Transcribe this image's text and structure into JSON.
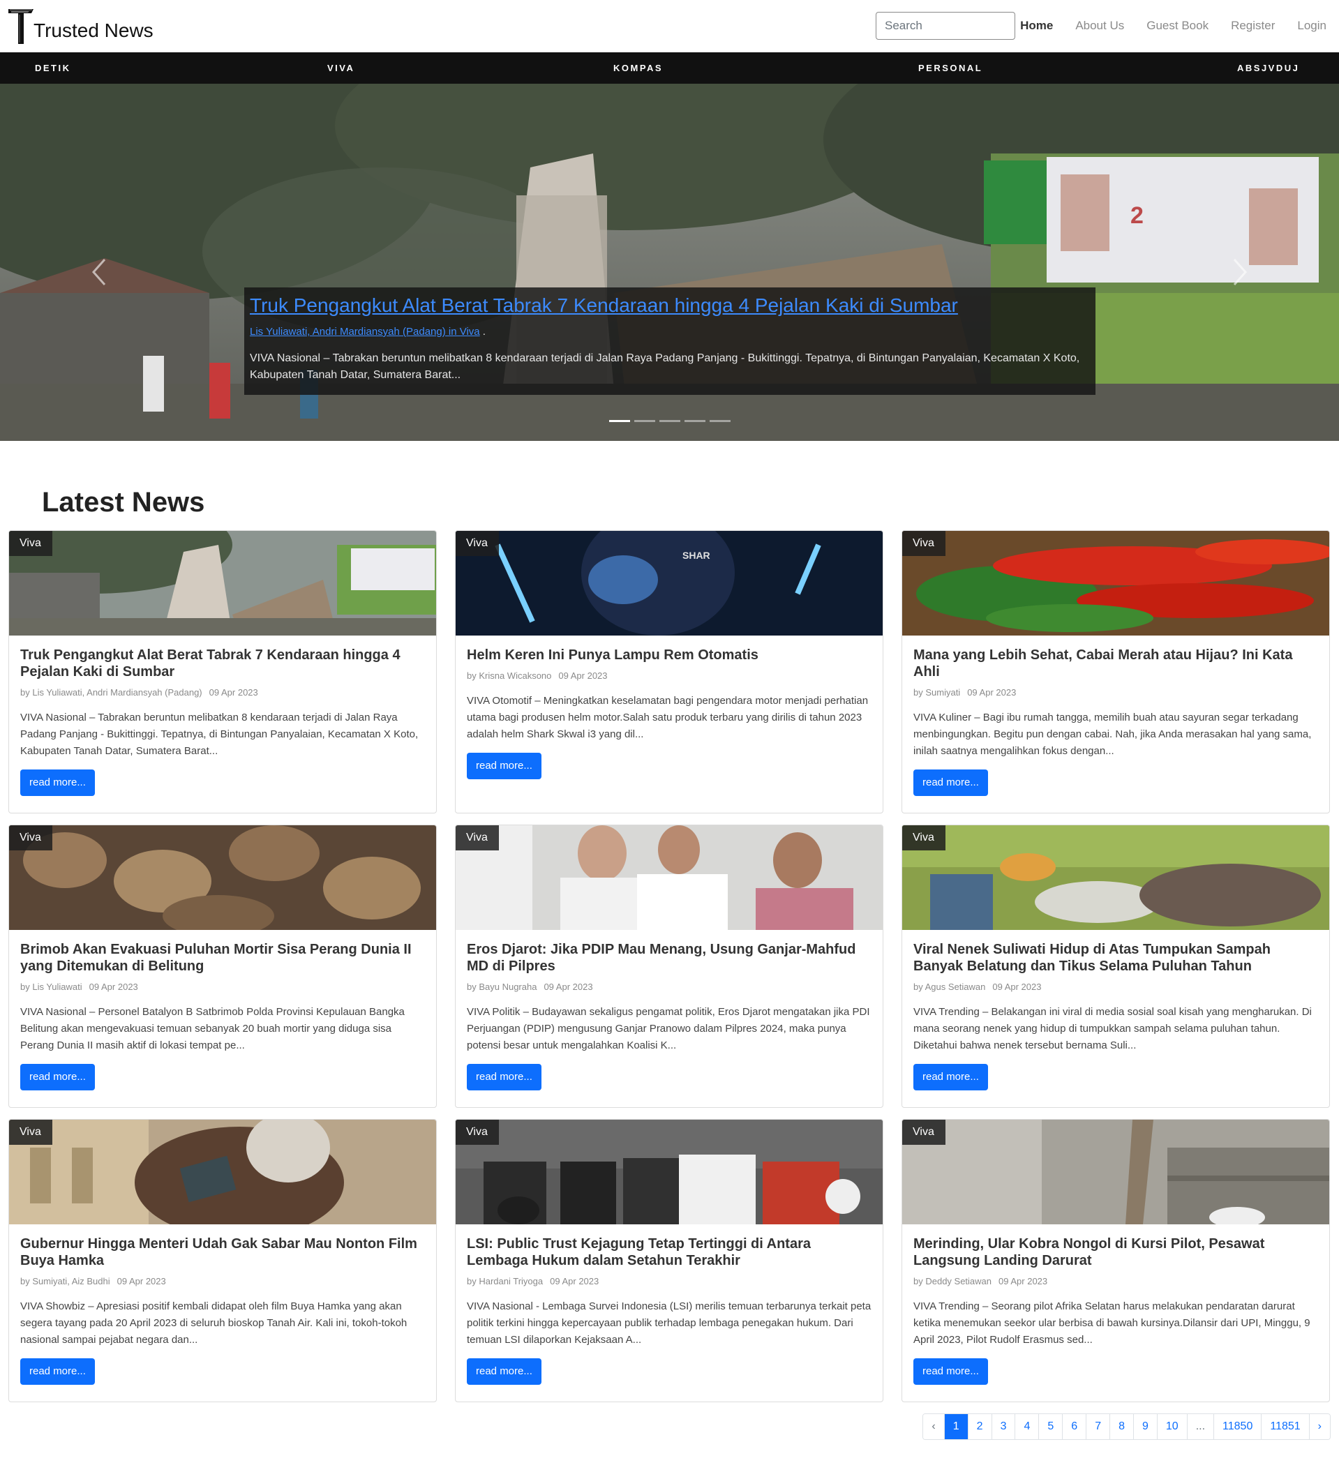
{
  "brand": {
    "logo_letter": "T",
    "name": "Trusted News"
  },
  "search": {
    "placeholder": "Search"
  },
  "nav": [
    {
      "label": "Home",
      "active": true
    },
    {
      "label": "About Us",
      "active": false
    },
    {
      "label": "Guest Book",
      "active": false
    },
    {
      "label": "Register",
      "active": false
    },
    {
      "label": "Login",
      "active": false
    }
  ],
  "categories": [
    "DETIK",
    "VIVA",
    "KOMPAS",
    "PERSONAL",
    "ABSJVDUJ"
  ],
  "hero": {
    "title": "Truk Pengangkut Alat Berat Tabrak 7 Kendaraan hingga 4 Pejalan Kaki di Sumbar",
    "author": "Lis Yuliawati, Andri Mardiansyah (Padang) in Viva",
    "author_suffix": " .",
    "excerpt": "VIVA Nasional – Tabrakan beruntun melibatkan 8 kendaraan terjadi di Jalan Raya Padang Panjang - Bukittinggi. Tepatnya, di Bintungan Panyalaian, Kecamatan X Koto, Kabupaten Tanah Datar, Sumatera Barat...",
    "prev_icon": "chevron-left-icon",
    "next_icon": "chevron-right-icon",
    "slides_total": 5,
    "active_slide": 1
  },
  "section_title": "Latest News",
  "read_more": "read more...",
  "cards": [
    {
      "badge": "Viva",
      "title": "Truk Pengangkut Alat Berat Tabrak 7 Kendaraan hingga 4 Pejalan Kaki di Sumbar",
      "author": "by Lis Yuliawati, Andri Mardiansyah (Padang)",
      "date": "09 Apr 2023",
      "excerpt": "VIVA Nasional – Tabrakan beruntun melibatkan 8 kendaraan terjadi di Jalan Raya Padang Panjang - Bukittinggi. Tepatnya, di Bintungan Panyalaian, Kecamatan X Koto, Kabupaten Tanah Datar, Sumatera Barat..."
    },
    {
      "badge": "Viva",
      "title": "Helm Keren Ini Punya Lampu Rem Otomatis",
      "author": "by Krisna Wicaksono",
      "date": "09 Apr 2023",
      "excerpt": "VIVA Otomotif – Meningkatkan keselamatan bagi pengendara motor menjadi perhatian utama bagi produsen helm motor.Salah satu produk terbaru yang dirilis di tahun 2023 adalah helm Shark Skwal i3 yang dil..."
    },
    {
      "badge": "Viva",
      "title": "Mana yang Lebih Sehat, Cabai Merah atau Hijau? Ini Kata Ahli",
      "author": "by Sumiyati",
      "date": "09 Apr 2023",
      "excerpt": "VIVA Kuliner – Bagi ibu rumah tangga, memilih buah atau sayuran segar terkadang menbingungkan. Begitu pun dengan cabai. Nah, jika Anda merasakan hal yang sama, inilah saatnya mengalihkan fokus dengan..."
    },
    {
      "badge": "Viva",
      "title": "Brimob Akan Evakuasi Puluhan Mortir Sisa Perang Dunia II yang Ditemukan di Belitung",
      "author": "by Lis Yuliawati",
      "date": "09 Apr 2023",
      "excerpt": "VIVA Nasional – Personel Batalyon B Satbrimob Polda Provinsi Kepulauan Bangka Belitung akan mengevakuasi temuan sebanyak 20 buah mortir yang diduga sisa Perang Dunia II masih aktif di lokasi tempat pe..."
    },
    {
      "badge": "Viva",
      "title": "Eros Djarot: Jika PDIP Mau Menang, Usung Ganjar-Mahfud MD di Pilpres",
      "author": "by Bayu Nugraha",
      "date": "09 Apr 2023",
      "excerpt": "VIVA Politik – Budayawan sekaligus pengamat politik, Eros Djarot mengatakan jika PDI Perjuangan (PDIP) mengusung Ganjar Pranowo dalam Pilpres 2024, maka punya potensi besar untuk mengalahkan Koalisi K..."
    },
    {
      "badge": "Viva",
      "title": "Viral Nenek Suliwati Hidup di Atas Tumpukan Sampah Banyak Belatung dan Tikus Selama Puluhan Tahun",
      "author": "by Agus Setiawan",
      "date": "09 Apr 2023",
      "excerpt": "VIVA Trending – Belakangan ini viral di media sosial soal kisah yang mengharukan. Di mana seorang nenek yang hidup di tumpukkan sampah selama puluhan tahun. Diketahui bahwa nenek tersebut bernama Suli..."
    },
    {
      "badge": "Viva",
      "title": "Gubernur Hingga Menteri Udah Gak Sabar Mau Nonton Film Buya Hamka",
      "author": "by Sumiyati, Aiz Budhi",
      "date": "09 Apr 2023",
      "excerpt": "VIVA Showbiz – Apresiasi positif kembali didapat oleh film Buya Hamka yang akan segera tayang pada 20 April 2023 di seluruh bioskop Tanah Air. Kali ini, tokoh-tokoh nasional sampai pejabat negara dan..."
    },
    {
      "badge": "Viva",
      "title": "LSI: Public Trust Kejagung Tetap Tertinggi di Antara Lembaga Hukum dalam Setahun Terakhir",
      "author": "by Hardani Triyoga",
      "date": "09 Apr 2023",
      "excerpt": "VIVA Nasional - Lembaga Survei Indonesia (LSI) merilis temuan terbarunya terkait peta politik terkini hingga kepercayaan publik terhadap lembaga penegakan hukum. Dari temuan LSI dilaporkan Kejaksaan A..."
    },
    {
      "badge": "Viva",
      "title": "Merinding, Ular Kobra Nongol di Kursi  Pilot, Pesawat Langsung Landing Darurat",
      "author": "by Deddy Setiawan",
      "date": "09 Apr 2023",
      "excerpt": "VIVA Trending – Seorang pilot Afrika Selatan harus melakukan pendaratan darurat ketika menemukan seekor ular berbisa di bawah kursinya.Dilansir dari UPI, Minggu, 9 April 2023, Pilot Rudolf Erasmus sed..."
    }
  ],
  "pagination": {
    "prev": "‹",
    "next": "›",
    "pages": [
      "1",
      "2",
      "3",
      "4",
      "5",
      "6",
      "7",
      "8",
      "9",
      "10",
      "...",
      "11850",
      "11851"
    ],
    "active": "1"
  }
}
